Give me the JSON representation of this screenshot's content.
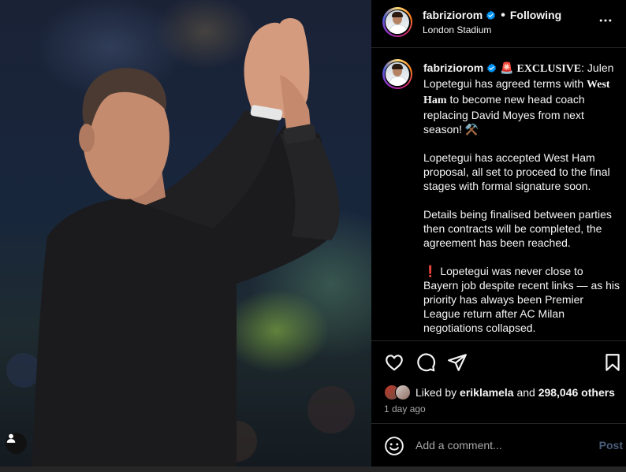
{
  "post": {
    "photo_alt": "Manager applauding fans",
    "header": {
      "username": "fabriziorom",
      "separator": "•",
      "follow_state": "Following",
      "location": "London Stadium"
    },
    "caption": {
      "username": "fabriziorom",
      "emoji_siren": "🚨",
      "p1_a": "EXCLUSIVE",
      "p1_b": ": Julen Lopetegui has agreed terms with ",
      "p1_c": "West Ham",
      "p1_d": " to become new head coach replacing David Moyes from next season! ⚒️",
      "p2": "Lopetegui has accepted West Ham proposal, all set to proceed to the final stages with formal signature soon.",
      "p3": "Details being finalised between parties then contracts will be completed, the agreement has been reached.",
      "p4_emoji": "❗️",
      "p4": " Lopetegui was never close to Bayern job despite recent links — as his priority has always been Premier League return after AC Milan negotiations collapsed."
    },
    "likes": {
      "prefix": "Liked by",
      "user": "eriklamela",
      "conj": "and",
      "others": "298,046 others"
    },
    "time": "1 day ago",
    "comment": {
      "placeholder": "Add a comment...",
      "post_label": "Post"
    }
  },
  "colors": {
    "background": "#000000",
    "text": "#f5f5f5",
    "secondary_text": "#a8a8a8",
    "verified": "#0095f6",
    "post_disabled": "#4a5d7a",
    "divider": "#262626"
  },
  "icons": [
    "user-tag-icon",
    "verified-badge-icon",
    "more-options-icon",
    "heart-icon",
    "comment-icon",
    "share-icon",
    "bookmark-icon",
    "emoji-icon"
  ]
}
